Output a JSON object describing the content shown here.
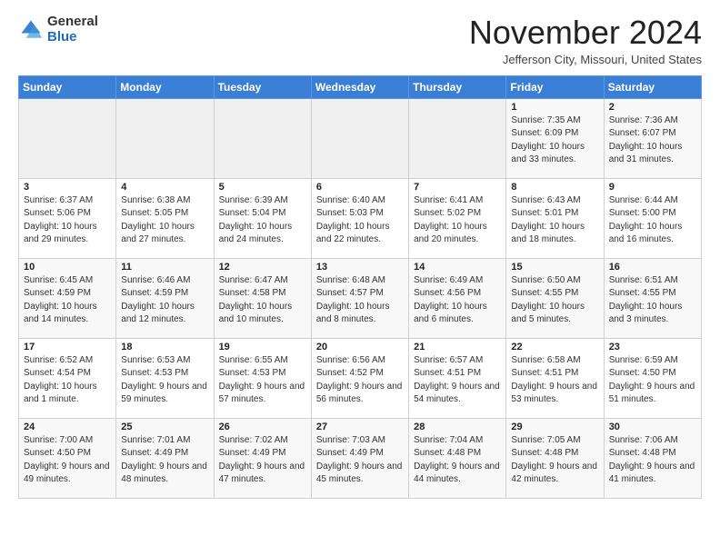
{
  "header": {
    "logo_general": "General",
    "logo_blue": "Blue",
    "month_title": "November 2024",
    "subtitle": "Jefferson City, Missouri, United States"
  },
  "days_of_week": [
    "Sunday",
    "Monday",
    "Tuesday",
    "Wednesday",
    "Thursday",
    "Friday",
    "Saturday"
  ],
  "weeks": [
    [
      {
        "day": "",
        "content": ""
      },
      {
        "day": "",
        "content": ""
      },
      {
        "day": "",
        "content": ""
      },
      {
        "day": "",
        "content": ""
      },
      {
        "day": "",
        "content": ""
      },
      {
        "day": "1",
        "content": "Sunrise: 7:35 AM\nSunset: 6:09 PM\nDaylight: 10 hours and 33 minutes."
      },
      {
        "day": "2",
        "content": "Sunrise: 7:36 AM\nSunset: 6:07 PM\nDaylight: 10 hours and 31 minutes."
      }
    ],
    [
      {
        "day": "3",
        "content": "Sunrise: 6:37 AM\nSunset: 5:06 PM\nDaylight: 10 hours and 29 minutes."
      },
      {
        "day": "4",
        "content": "Sunrise: 6:38 AM\nSunset: 5:05 PM\nDaylight: 10 hours and 27 minutes."
      },
      {
        "day": "5",
        "content": "Sunrise: 6:39 AM\nSunset: 5:04 PM\nDaylight: 10 hours and 24 minutes."
      },
      {
        "day": "6",
        "content": "Sunrise: 6:40 AM\nSunset: 5:03 PM\nDaylight: 10 hours and 22 minutes."
      },
      {
        "day": "7",
        "content": "Sunrise: 6:41 AM\nSunset: 5:02 PM\nDaylight: 10 hours and 20 minutes."
      },
      {
        "day": "8",
        "content": "Sunrise: 6:43 AM\nSunset: 5:01 PM\nDaylight: 10 hours and 18 minutes."
      },
      {
        "day": "9",
        "content": "Sunrise: 6:44 AM\nSunset: 5:00 PM\nDaylight: 10 hours and 16 minutes."
      }
    ],
    [
      {
        "day": "10",
        "content": "Sunrise: 6:45 AM\nSunset: 4:59 PM\nDaylight: 10 hours and 14 minutes."
      },
      {
        "day": "11",
        "content": "Sunrise: 6:46 AM\nSunset: 4:59 PM\nDaylight: 10 hours and 12 minutes."
      },
      {
        "day": "12",
        "content": "Sunrise: 6:47 AM\nSunset: 4:58 PM\nDaylight: 10 hours and 10 minutes."
      },
      {
        "day": "13",
        "content": "Sunrise: 6:48 AM\nSunset: 4:57 PM\nDaylight: 10 hours and 8 minutes."
      },
      {
        "day": "14",
        "content": "Sunrise: 6:49 AM\nSunset: 4:56 PM\nDaylight: 10 hours and 6 minutes."
      },
      {
        "day": "15",
        "content": "Sunrise: 6:50 AM\nSunset: 4:55 PM\nDaylight: 10 hours and 5 minutes."
      },
      {
        "day": "16",
        "content": "Sunrise: 6:51 AM\nSunset: 4:55 PM\nDaylight: 10 hours and 3 minutes."
      }
    ],
    [
      {
        "day": "17",
        "content": "Sunrise: 6:52 AM\nSunset: 4:54 PM\nDaylight: 10 hours and 1 minute."
      },
      {
        "day": "18",
        "content": "Sunrise: 6:53 AM\nSunset: 4:53 PM\nDaylight: 9 hours and 59 minutes."
      },
      {
        "day": "19",
        "content": "Sunrise: 6:55 AM\nSunset: 4:53 PM\nDaylight: 9 hours and 57 minutes."
      },
      {
        "day": "20",
        "content": "Sunrise: 6:56 AM\nSunset: 4:52 PM\nDaylight: 9 hours and 56 minutes."
      },
      {
        "day": "21",
        "content": "Sunrise: 6:57 AM\nSunset: 4:51 PM\nDaylight: 9 hours and 54 minutes."
      },
      {
        "day": "22",
        "content": "Sunrise: 6:58 AM\nSunset: 4:51 PM\nDaylight: 9 hours and 53 minutes."
      },
      {
        "day": "23",
        "content": "Sunrise: 6:59 AM\nSunset: 4:50 PM\nDaylight: 9 hours and 51 minutes."
      }
    ],
    [
      {
        "day": "24",
        "content": "Sunrise: 7:00 AM\nSunset: 4:50 PM\nDaylight: 9 hours and 49 minutes."
      },
      {
        "day": "25",
        "content": "Sunrise: 7:01 AM\nSunset: 4:49 PM\nDaylight: 9 hours and 48 minutes."
      },
      {
        "day": "26",
        "content": "Sunrise: 7:02 AM\nSunset: 4:49 PM\nDaylight: 9 hours and 47 minutes."
      },
      {
        "day": "27",
        "content": "Sunrise: 7:03 AM\nSunset: 4:49 PM\nDaylight: 9 hours and 45 minutes."
      },
      {
        "day": "28",
        "content": "Sunrise: 7:04 AM\nSunset: 4:48 PM\nDaylight: 9 hours and 44 minutes."
      },
      {
        "day": "29",
        "content": "Sunrise: 7:05 AM\nSunset: 4:48 PM\nDaylight: 9 hours and 42 minutes."
      },
      {
        "day": "30",
        "content": "Sunrise: 7:06 AM\nSunset: 4:48 PM\nDaylight: 9 hours and 41 minutes."
      }
    ]
  ]
}
